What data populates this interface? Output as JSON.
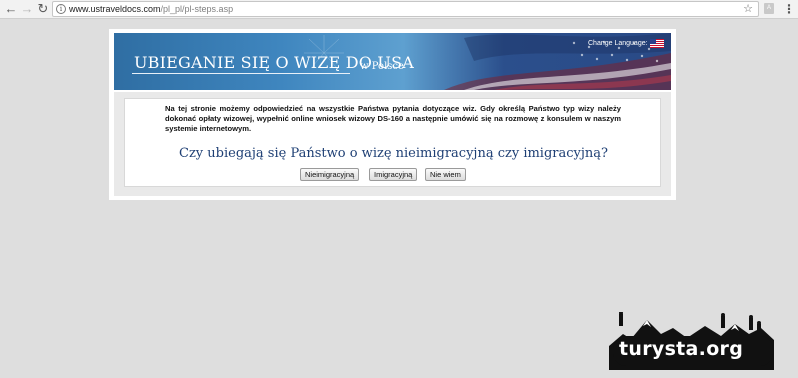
{
  "browser": {
    "url_host": "www.ustraveldocs.com",
    "url_path": "/pl_pl/pl-steps.asp",
    "back_icon": "arrow-left-icon",
    "forward_icon": "arrow-right-icon",
    "reload_icon": "reload-icon"
  },
  "banner": {
    "title": "UBIEGANIE SIĘ O WIZĘ DO USA",
    "subtitle": "w Polsce",
    "change_language": "Change Language:"
  },
  "content": {
    "intro": "Na tej stronie możemy odpowiedzieć na wszystkie Państwa pytania dotyczące wiz. Gdy określą Państwo typ wizy należy dokonać opłaty wizowej, wypełnić online wniosek wizowy DS-160 a następnie umówić się na rozmowę z konsulem w naszym systemie internetowym.",
    "question": "Czy ubiegają się Państwo o wizę nieimigracyjną czy imigracyjną?",
    "buttons": {
      "nonimmigrant": "Nieimigracyjną",
      "immigrant": "Imigracyjną",
      "unknown": "Nie wiem"
    }
  },
  "colors": {
    "page_bg": "#dedede",
    "question": "#1e3f74",
    "banner_blue": "#3f86bf"
  }
}
